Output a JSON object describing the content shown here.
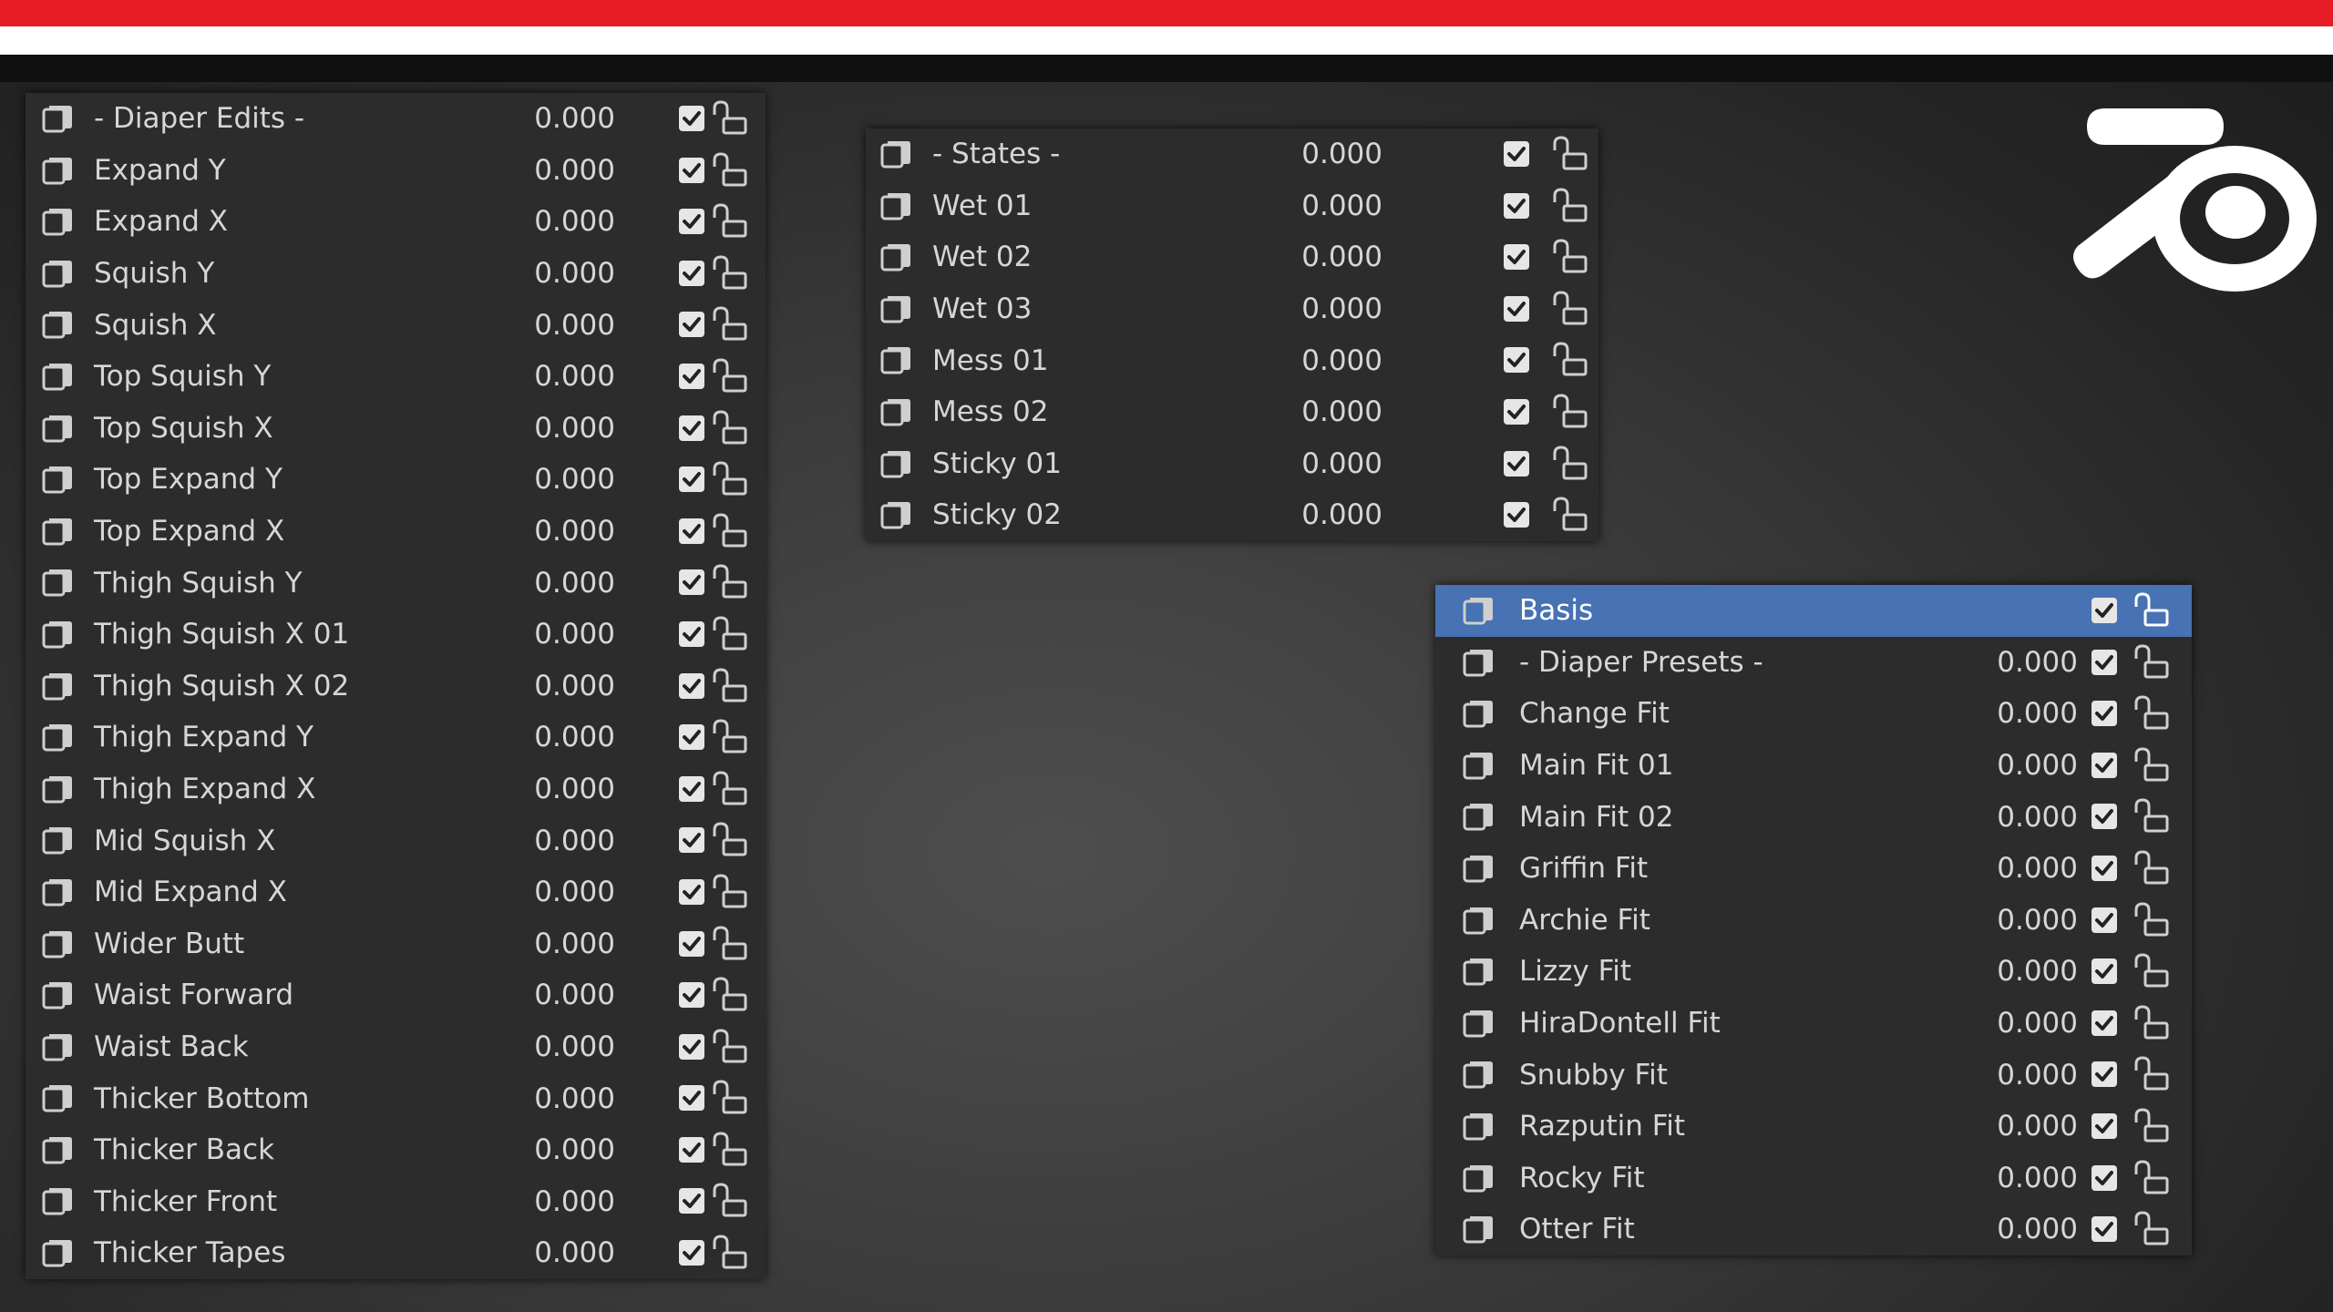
{
  "colors": {
    "banner_red": "#e81c24",
    "panel_bg": "#2c2c2c",
    "active_row": "#4772b3",
    "text": "#d6d6d6"
  },
  "panels": {
    "left": {
      "rows": [
        {
          "name": "- Diaper Edits -",
          "value": "0.000"
        },
        {
          "name": "Expand Y",
          "value": "0.000"
        },
        {
          "name": "Expand X",
          "value": "0.000"
        },
        {
          "name": "Squish Y",
          "value": "0.000"
        },
        {
          "name": "Squish X",
          "value": "0.000"
        },
        {
          "name": "Top Squish Y",
          "value": "0.000"
        },
        {
          "name": "Top Squish X",
          "value": "0.000"
        },
        {
          "name": "Top Expand Y",
          "value": "0.000"
        },
        {
          "name": "Top Expand X",
          "value": "0.000"
        },
        {
          "name": "Thigh Squish Y",
          "value": "0.000"
        },
        {
          "name": "Thigh Squish X 01",
          "value": "0.000"
        },
        {
          "name": "Thigh Squish X 02",
          "value": "0.000"
        },
        {
          "name": "Thigh Expand Y",
          "value": "0.000"
        },
        {
          "name": "Thigh Expand X",
          "value": "0.000"
        },
        {
          "name": "Mid Squish X",
          "value": "0.000"
        },
        {
          "name": "Mid Expand X",
          "value": "0.000"
        },
        {
          "name": "Wider Butt",
          "value": "0.000"
        },
        {
          "name": "Waist Forward",
          "value": "0.000"
        },
        {
          "name": "Waist Back",
          "value": "0.000"
        },
        {
          "name": "Thicker Bottom",
          "value": "0.000"
        },
        {
          "name": "Thicker Back",
          "value": "0.000"
        },
        {
          "name": "Thicker Front",
          "value": "0.000"
        },
        {
          "name": "Thicker Tapes",
          "value": "0.000"
        }
      ]
    },
    "states": {
      "rows": [
        {
          "name": "- States -",
          "value": "0.000"
        },
        {
          "name": "Wet 01",
          "value": "0.000"
        },
        {
          "name": "Wet 02",
          "value": "0.000"
        },
        {
          "name": "Wet 03",
          "value": "0.000"
        },
        {
          "name": "Mess 01",
          "value": "0.000"
        },
        {
          "name": "Mess 02",
          "value": "0.000"
        },
        {
          "name": "Sticky 01",
          "value": "0.000"
        },
        {
          "name": "Sticky 02",
          "value": "0.000"
        }
      ]
    },
    "presets": {
      "rows": [
        {
          "name": "Basis",
          "value": "",
          "active": true
        },
        {
          "name": "- Diaper Presets -",
          "value": "0.000"
        },
        {
          "name": "Change Fit",
          "value": "0.000"
        },
        {
          "name": "Main Fit 01",
          "value": "0.000"
        },
        {
          "name": "Main Fit 02",
          "value": "0.000"
        },
        {
          "name": "Griffin Fit",
          "value": "0.000"
        },
        {
          "name": "Archie Fit",
          "value": "0.000"
        },
        {
          "name": "Lizzy Fit",
          "value": "0.000"
        },
        {
          "name": "HiraDontell Fit",
          "value": "0.000"
        },
        {
          "name": "Snubby Fit",
          "value": "0.000"
        },
        {
          "name": "Razputin Fit",
          "value": "0.000"
        },
        {
          "name": "Rocky Fit",
          "value": "0.000"
        },
        {
          "name": "Otter Fit",
          "value": "0.000"
        }
      ]
    }
  },
  "icons": {
    "shape_key": "shape-key-icon",
    "checkbox": "checkbox-checked-icon",
    "lock": "unlocked-icon",
    "logo": "blender-logo-icon"
  }
}
